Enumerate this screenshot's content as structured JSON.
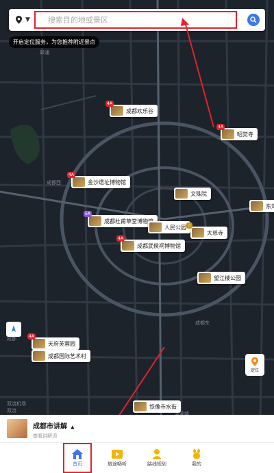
{
  "search": {
    "placeholder": "搜索目的地或景区"
  },
  "hint": "开启定位服务，为您推荐附近景点",
  "poi": [
    {
      "label": "成都欢乐谷",
      "badge": "4A"
    },
    {
      "label": "昭觉寺",
      "badge": "4A"
    },
    {
      "label": "金沙遗址博物馆",
      "badge": "4A"
    },
    {
      "label": "文殊院",
      "badge": ""
    },
    {
      "label": "东郊",
      "badge": ""
    },
    {
      "label": "成都杜甫草堂博物馆",
      "badge": "5A"
    },
    {
      "label": "人民公园",
      "badge": ""
    },
    {
      "label": "大慈寺",
      "badge": ""
    },
    {
      "label": "成都武侯祠博物馆",
      "badge": "4A"
    },
    {
      "label": "望江楼公园",
      "badge": ""
    },
    {
      "label": "天府芙蓉园",
      "badge": "4A"
    },
    {
      "label": "成都国际艺术村",
      "badge": ""
    },
    {
      "label": "铁像寺水街",
      "badge": ""
    }
  ],
  "map_labels": [
    "犀浦",
    "成都西",
    "成都东",
    "双流机场",
    "双流",
    "洞溪镇",
    "成都"
  ],
  "locate_label": "定位",
  "info": {
    "title": "成都市讲解",
    "subtitle": "查看讲解词"
  },
  "tabs": [
    "首页",
    "旅途畅听",
    "路线规划",
    "我的"
  ],
  "colors": {
    "accent": "#3d78e8",
    "highlight": "#e0242a"
  }
}
